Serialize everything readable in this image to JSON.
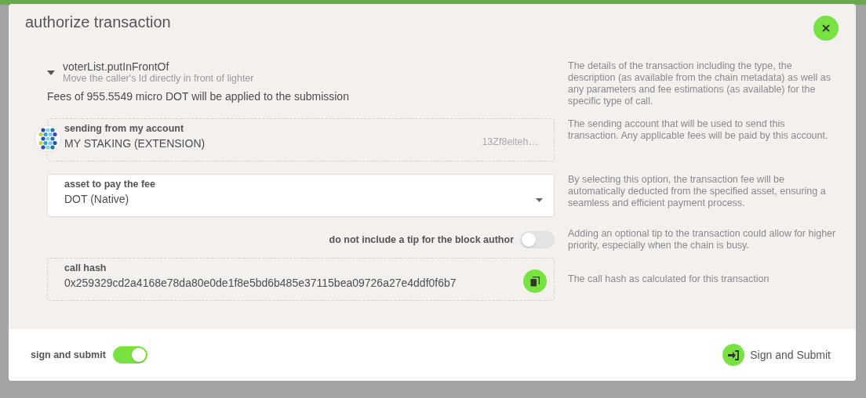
{
  "window": {
    "title": "authorize transaction"
  },
  "call": {
    "expanded": true,
    "method": "voterList.putInFrontOf",
    "description": "Move the caller's Id directly in front of lighter",
    "fees": "Fees of 955.5549 micro DOT will be applied to the submission",
    "help": "The details of the transaction including the type, the description (as available from the chain metadata) as well as any parameters and fee estimations (as available) for the specific type of call."
  },
  "account": {
    "label": "sending from my account",
    "name": "MY STAKING (EXTENSION)",
    "address": "13Zf8eiteh…",
    "help": "The sending account that will be used to send this transaction. Any applicable fees will be paid by this account."
  },
  "asset": {
    "label": "asset to pay the fee",
    "value": "DOT (Native)",
    "help": "By selecting this option, the transaction fee will be automatically deducted from the specified asset, ensuring a seamless and efficient payment process."
  },
  "tip": {
    "label": "do not include a tip for the block author",
    "on": false,
    "help": "Adding an optional tip to the transaction could allow for higher priority, especially when the chain is busy."
  },
  "call_hash": {
    "label": "call hash",
    "value": "0x259329cd2a4168e78da80e0de1f8e5bd6b485e37115bea09726a27e4ddf0f6b7",
    "help": "The call hash as calculated for this transaction"
  },
  "footer": {
    "toggle_label": "sign and submit",
    "toggle_on": true,
    "button": "Sign and Submit"
  }
}
